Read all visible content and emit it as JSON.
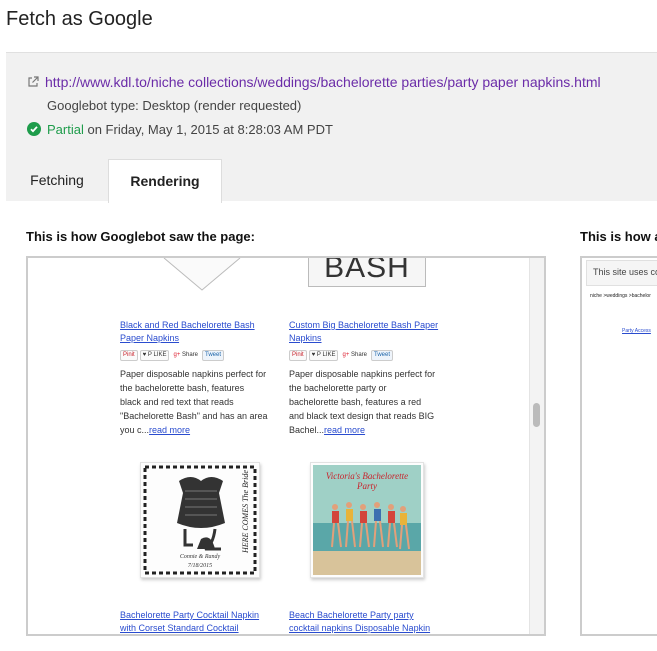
{
  "page_title": "Fetch as Google",
  "fetch": {
    "url": "http://www.kdl.to/niche collections/weddings/bachelorette parties/party paper napkins.html",
    "googlebot_type": "Googlebot type: Desktop (render requested)",
    "status_word": "Partial",
    "status_date": " on Friday, May 1, 2015 at 8:28:03 AM PDT"
  },
  "tabs": [
    {
      "label": "Fetching"
    },
    {
      "label": "Rendering"
    }
  ],
  "left_panel": {
    "label": "This is how Googlebot saw the page:",
    "top_graphic_text": "BASH",
    "products": [
      {
        "title_line1": "Black and Red Bachelorette Bash",
        "title_line2": "Paper Napkins",
        "desc_lines": [
          "Paper disposable napkins perfect for",
          "the bachelorette bash, features",
          "black and red text that reads",
          "\"Bachelorette Bash\" and has an area",
          "you c..."
        ],
        "read_more": "read more"
      },
      {
        "title_line1": "Custom Big Bachelorette Bash Paper",
        "title_line2": "Napkins",
        "desc_lines": [
          "Paper disposable napkins perfect for",
          "the bachelorette party or",
          "bachelorette bash, features a red",
          "and black text design that reads BIG",
          "Bachel..."
        ],
        "read_more": "read more"
      },
      {
        "title_line1": "Bachelorette Party Cocktail Napkin",
        "title_line2": "with Corset Standard Cocktail"
      },
      {
        "title_line1": "Beach Bachelorette Party party",
        "title_line2": "cocktail napkins Disposable Napkin"
      }
    ],
    "share_buttons": [
      "Pinit",
      "♥ P LIKE",
      "Share",
      "Tweet"
    ],
    "corset_image_text": {
      "side": "HERE COMES The Bride",
      "names": "Connie & Randy",
      "date": "7/18/2015"
    },
    "beach_image_text": {
      "title": "Victoria's Bachelorette",
      "subtitle": "Party"
    }
  },
  "right_panel": {
    "label": "This is how a",
    "banner": "This site uses co",
    "breadcrumb": "niche >weddings >bachelor",
    "link": "Party Access"
  },
  "colors": {
    "link": "#6b2ca8",
    "status_ok": "#1e9c4b",
    "panel_bg": "#f1f1f1"
  }
}
